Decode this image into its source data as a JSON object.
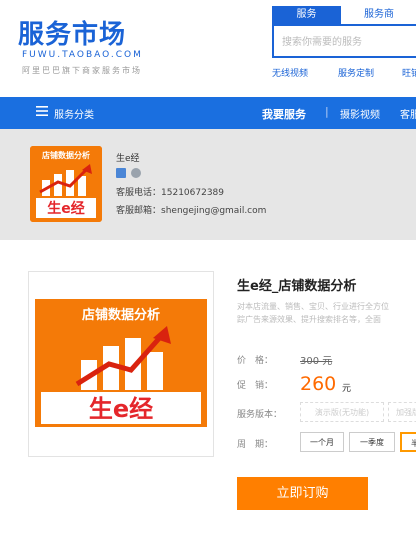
{
  "header": {
    "logo_cn": "服务市场",
    "logo_en": "FUWU.TAOBAO.COM",
    "logo_tagline": "阿里巴巴旗下商家服务市场",
    "search_tabs": [
      "服务",
      "服务商"
    ],
    "search_placeholder": "搜索你需要的服务",
    "hot_links": [
      "无线视频",
      "服务定制",
      "旺铺"
    ]
  },
  "nav": {
    "category_label": "服务分类",
    "main_label": "我要服务",
    "separator": "|",
    "photo_label": "摄影视频",
    "cs_label": "客服"
  },
  "shop": {
    "logo_text_top": "店铺数据分析",
    "logo_text_bottom": "生e经",
    "name": "生e经",
    "phone_label": "客服电话：",
    "phone": "15210672389",
    "email_label": "客服邮箱：",
    "email": "shengejing@gmail.com"
  },
  "product": {
    "image_text_top": "店铺数据分析",
    "image_text_bottom": "生e经",
    "title": "生e经_店铺数据分析",
    "desc_line1": "对本店流量、销售、宝贝、行业进行全方位",
    "desc_line2": "踪广告来源效果、提升搜索排名等，全面",
    "price_label": "价　格：",
    "price": "300 元",
    "promo_label": "促　销：",
    "promo_price": "260",
    "promo_unit": "元",
    "version_label": "服务版本：",
    "versions": [
      "演示版(无功能)",
      "加强版"
    ],
    "period_label": "周　期：",
    "periods": [
      "一个月",
      "一季度",
      "半"
    ],
    "order_button": "立即订购"
  },
  "colors": {
    "brand_blue": "#1a63d6",
    "nav_blue": "#1a6fe0",
    "orange": "#ff7f00"
  }
}
